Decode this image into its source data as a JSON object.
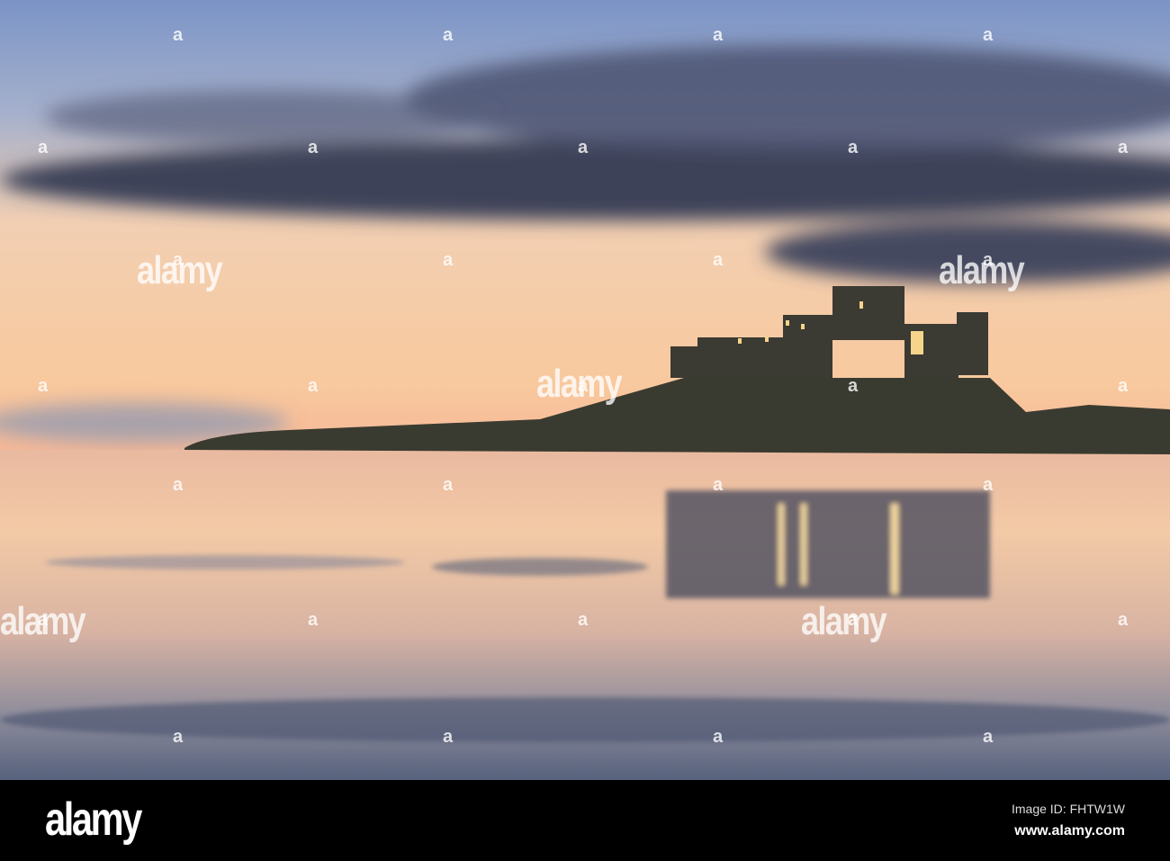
{
  "photo": {
    "subject": "castle-on-hill-beach-sunset",
    "colors": {
      "sky_top": "#7f97c4",
      "sky_mid": "#d9c4c0",
      "sky_horizon": "#f7c79b",
      "cloud": "#3b4257",
      "land": "#2e3128",
      "sand_light": "#f2c6a4",
      "sand_dark": "#5e6982"
    }
  },
  "watermark": {
    "text": "alamy",
    "mark": "a"
  },
  "footer": {
    "logo": "alamy",
    "image_id": "Image ID: FHTW1W",
    "url": "www.alamy.com"
  }
}
